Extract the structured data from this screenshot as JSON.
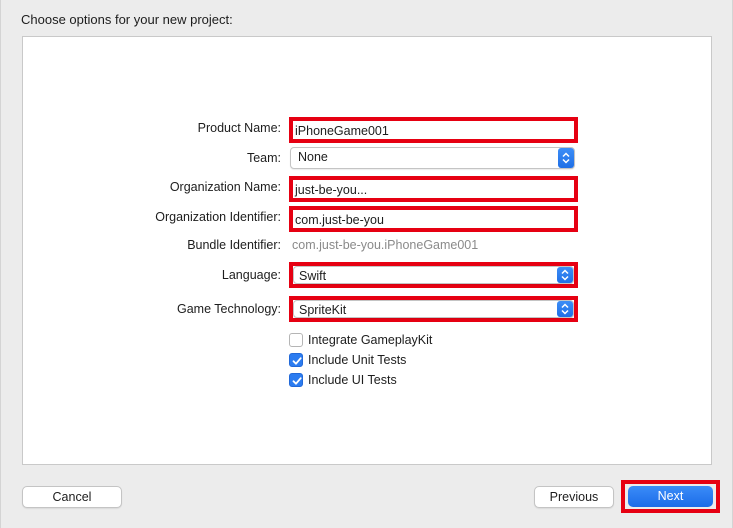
{
  "dialog": {
    "title": "Choose options for your new project:"
  },
  "form": {
    "product_name": {
      "label": "Product Name:",
      "value": "iPhoneGame001"
    },
    "team": {
      "label": "Team:",
      "value": "None"
    },
    "organization_name": {
      "label": "Organization Name:",
      "value": "just-be-you..."
    },
    "organization_identifier": {
      "label": "Organization Identifier:",
      "value": "com.just-be-you"
    },
    "bundle_identifier": {
      "label": "Bundle Identifier:",
      "value": "com.just-be-you.iPhoneGame001"
    },
    "language": {
      "label": "Language:",
      "value": "Swift"
    },
    "game_technology": {
      "label": "Game Technology:",
      "value": "SpriteKit"
    },
    "checkboxes": [
      {
        "label": "Integrate GameplayKit",
        "checked": false
      },
      {
        "label": "Include Unit Tests",
        "checked": true
      },
      {
        "label": "Include UI Tests",
        "checked": true
      }
    ]
  },
  "buttons": {
    "cancel": "Cancel",
    "previous": "Previous",
    "next": "Next"
  },
  "colors": {
    "highlight": "#e60012",
    "accent": "#2c7cf0",
    "panel": "#ffffff",
    "window": "#ececec"
  }
}
